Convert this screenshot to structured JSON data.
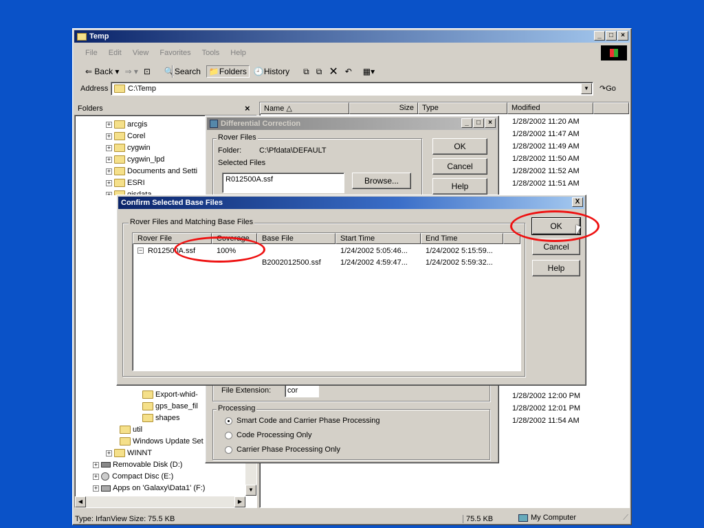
{
  "explorer": {
    "title": "Temp",
    "menu": [
      "File",
      "Edit",
      "View",
      "Favorites",
      "Tools",
      "Help"
    ],
    "toolbar": {
      "back": "Back",
      "search": "Search",
      "folders": "Folders",
      "history": "History"
    },
    "address_label": "Address",
    "address_value": "C:\\Temp",
    "go_label": "Go",
    "folders_pane_title": "Folders",
    "tree": [
      {
        "label": "arcgis",
        "sign": "+"
      },
      {
        "label": "Corel",
        "sign": "+"
      },
      {
        "label": "cygwin",
        "sign": "+"
      },
      {
        "label": "cygwin_lpd",
        "sign": "+"
      },
      {
        "label": "Documents and Setti",
        "sign": "+"
      },
      {
        "label": "ESRI",
        "sign": "+"
      },
      {
        "label": "gisdata",
        "sign": "+"
      }
    ],
    "tree_lower": [
      {
        "label": "Export-whid-"
      },
      {
        "label": "gps_base_fil"
      },
      {
        "label": "shapes"
      },
      {
        "label": "util"
      },
      {
        "label": "Windows Update Set"
      },
      {
        "label": "WINNT"
      },
      {
        "label": "Removable Disk (D:)"
      },
      {
        "label": "Compact Disc (E:)"
      },
      {
        "label": "Apps on 'Galaxy\\Data1' (F:)"
      }
    ],
    "columns": [
      "Name",
      "Size",
      "Type",
      "Modified"
    ],
    "modified_top": [
      "1/28/2002 11:20 AM",
      "1/28/2002 11:47 AM",
      "1/28/2002 11:49 AM",
      "1/28/2002 11:50 AM",
      "1/28/2002 11:52 AM",
      "1/28/2002 11:51 AM"
    ],
    "modified_bottom": [
      "1/28/2002 12:00 PM",
      "1/28/2002 12:01 PM",
      "1/28/2002 11:54 AM"
    ],
    "status_left": "Type: IrfanView Size: 75.5 KB",
    "status_size": "75.5 KB",
    "status_zone": "My Computer"
  },
  "diff": {
    "title": "Differential Correction",
    "rover_group": "Rover Files",
    "folder_label": "Folder:",
    "folder_value": "C:\\Pfdata\\DEFAULT",
    "selected_label": "Selected Files",
    "selected_file": "R012500A.ssf",
    "browse": "Browse...",
    "ok": "OK",
    "cancel": "Cancel",
    "help": "Help",
    "ext_label": "File Extension:",
    "ext_value": "cor",
    "processing_group": "Processing",
    "options": [
      "Smart Code and Carrier Phase Processing",
      "Code Processing Only",
      "Carrier Phase Processing Only"
    ]
  },
  "confirm": {
    "title": "Confirm Selected Base Files",
    "close": "X",
    "group": "Rover Files and Matching Base Files",
    "headers": [
      "Rover File",
      "Coverage",
      "Base File",
      "Start Time",
      "End Time"
    ],
    "rows": [
      {
        "rover": "R012500A.ssf",
        "coverage": "100%",
        "base": "",
        "start": "1/24/2002 5:05:46...",
        "end": "1/24/2002 5:15:59..."
      },
      {
        "rover": "",
        "coverage": "",
        "base": "B2002012500.ssf",
        "start": "1/24/2002 4:59:47...",
        "end": "1/24/2002 5:59:32..."
      }
    ],
    "ok": "OK",
    "cancel": "Cancel",
    "help": "Help"
  },
  "colors": {
    "desktop": "#0a52c8",
    "title_active": "#0a246a",
    "annotation": "#e11111"
  }
}
